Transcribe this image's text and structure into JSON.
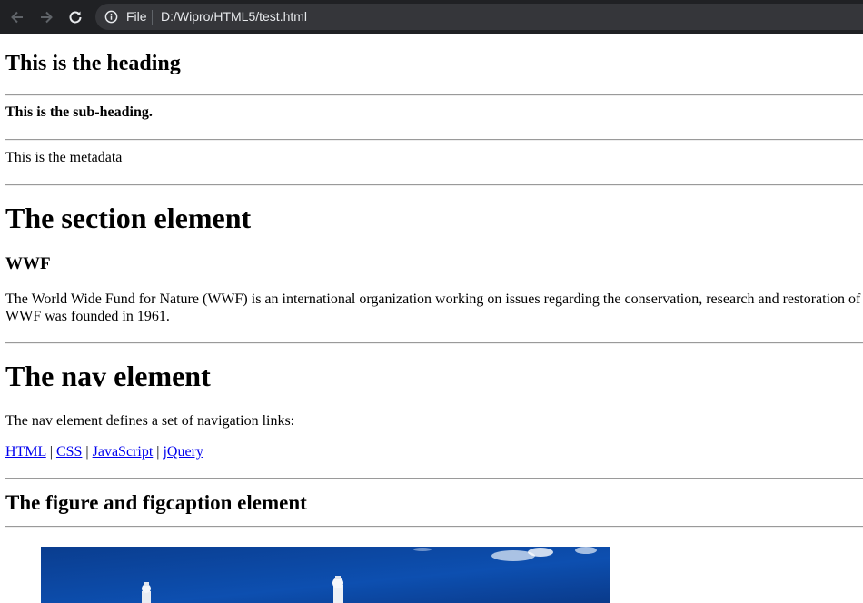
{
  "browser": {
    "back_icon": "arrow-left-icon",
    "forward_icon": "arrow-right-icon",
    "reload_icon": "reload-icon",
    "info_icon": "info-icon",
    "scheme_label": "File",
    "url": "D:/Wipro/HTML5/test.html"
  },
  "header": {
    "heading": "This is the heading",
    "subheading": "This is the sub-heading.",
    "metadata": "This is the metadata"
  },
  "section": {
    "title": "The section element",
    "subtitle": "WWF",
    "paragraph_line1": "The World Wide Fund for Nature (WWF) is an international organization working on issues regarding the conservation, research and restoration of",
    "paragraph_line2": "WWF was founded in 1961."
  },
  "nav": {
    "title": "The nav element",
    "description": "The nav element defines a set of navigation links:",
    "separator": " | ",
    "links": [
      "HTML",
      "CSS",
      "JavaScript",
      "jQuery"
    ],
    "link_color": "#0000ee"
  },
  "figure": {
    "title": "The figure and figcaption element"
  }
}
